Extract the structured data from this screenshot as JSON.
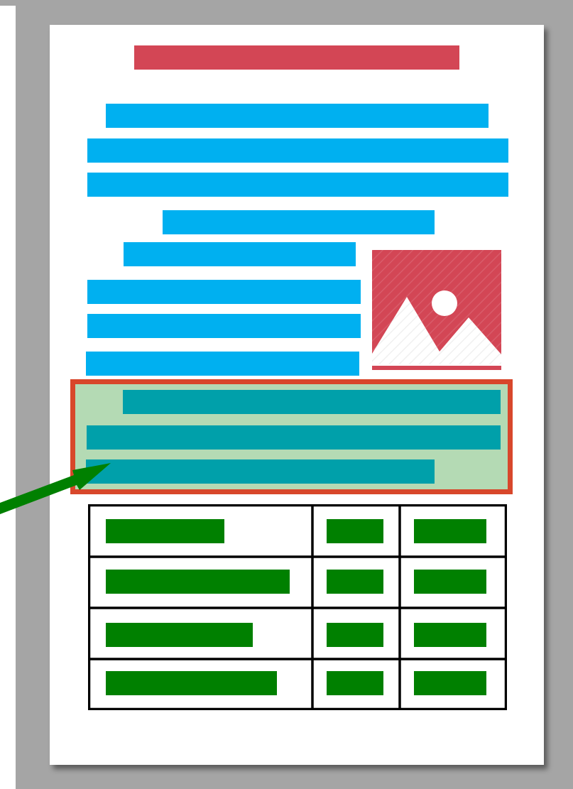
{
  "colors": {
    "background": "#a5a5a5",
    "page": "#ffffff",
    "title": "#d34655",
    "text": "#00b0f0",
    "highlight_text": "#00a0aa",
    "highlight_fill": "#b4dab4",
    "highlight_border": "#d8472b",
    "cell": "#008000",
    "grid": "#000000",
    "image": "#d34655",
    "arrow": "#008000"
  },
  "icons": {
    "image_placeholder": "image-icon",
    "pointer": "arrow-icon"
  },
  "table": {
    "rows": 4,
    "columns": 3
  }
}
